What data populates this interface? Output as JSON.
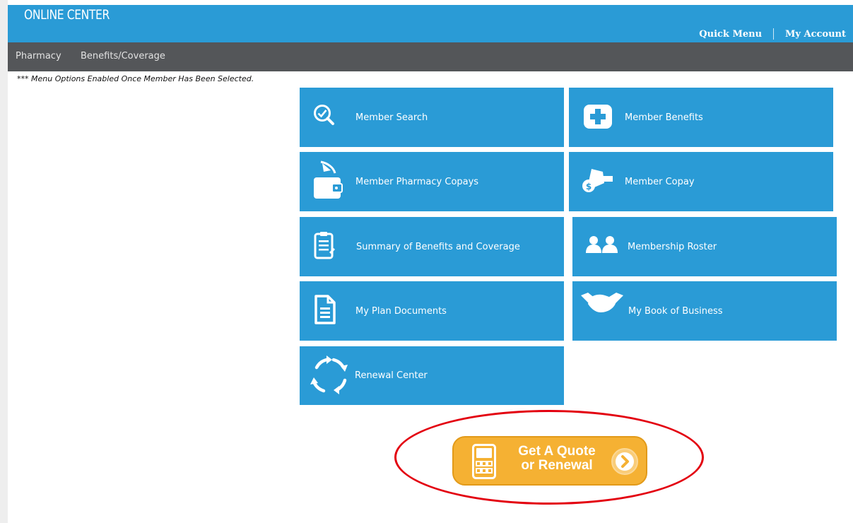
{
  "header": {
    "logo": "ONLINE CENTER",
    "quick_menu": "Quick Menu",
    "my_account": "My Account"
  },
  "nav": {
    "items": [
      "Pharmacy",
      "Benefits/Coverage"
    ]
  },
  "notice": "*** Menu Options Enabled Once Member Has Been Selected.",
  "tiles": {
    "member_search": "Member Search",
    "member_benefits": "Member Benefits",
    "member_pharmacy_copays": "Member Pharmacy Copays",
    "member_copay": "Member Copay",
    "summary_of_benefits": "Summary of Benefits and Coverage",
    "membership_roster": "Membership Roster",
    "my_plan_documents": "My Plan Documents",
    "my_book_of_business": "My Book of Business",
    "renewal_center": "Renewal Center"
  },
  "quote": {
    "line1": "Get A Quote",
    "line2": "or Renewal"
  },
  "colors": {
    "brand_blue": "#2a9bd6",
    "nav_gray": "#545659",
    "quote_orange": "#f5b133",
    "highlight_red": "#e3000f"
  }
}
